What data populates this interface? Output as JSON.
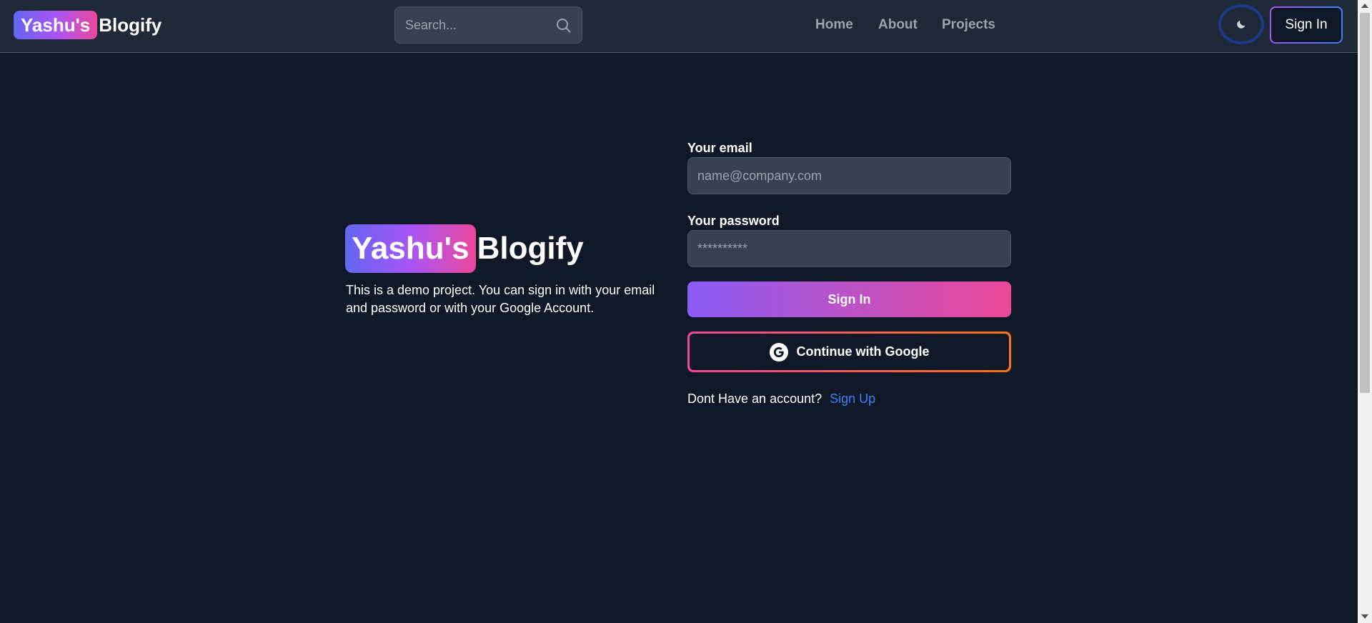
{
  "header": {
    "logo_badge": "Yashu's",
    "logo_rest": "Blogify",
    "search_placeholder": "Search...",
    "nav": [
      {
        "label": "Home"
      },
      {
        "label": "About"
      },
      {
        "label": "Projects"
      }
    ],
    "theme_icon": "moon-icon",
    "signin_label": "Sign In"
  },
  "intro": {
    "logo_badge": "Yashu's",
    "logo_rest": "Blogify",
    "description": "This is a demo project. You can sign in with your email and password or with your Google Account."
  },
  "form": {
    "email_label": "Your email",
    "email_placeholder": "name@company.com",
    "password_label": "Your password",
    "password_placeholder": "**********",
    "signin_label": "Sign In",
    "google_label": "Continue with Google",
    "no_account_text": "Dont Have an account?",
    "signup_link": "Sign Up"
  },
  "colors": {
    "background": "#111827",
    "header_bg": "#1f2937",
    "input_bg": "#374151",
    "accent_purple": "#8b5cf6",
    "accent_pink": "#ec4899",
    "link_blue": "#3b82f6"
  }
}
